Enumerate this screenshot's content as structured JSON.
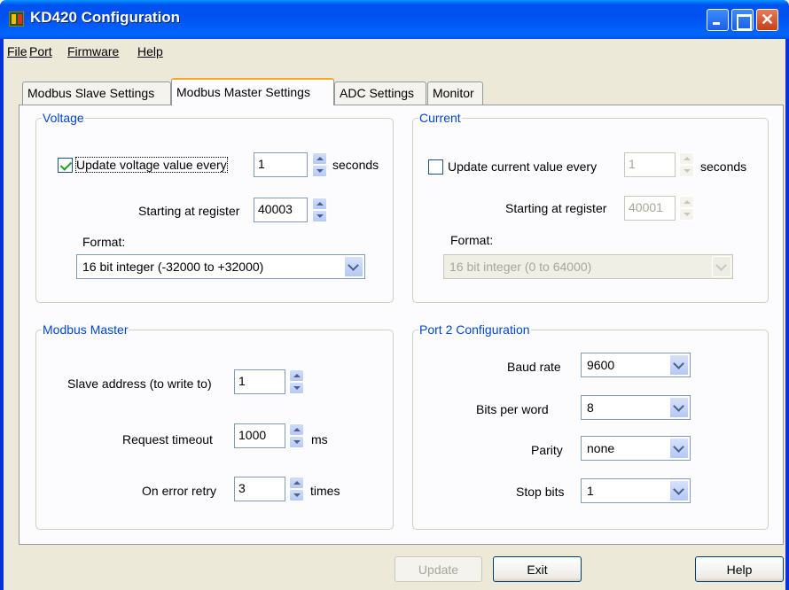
{
  "window": {
    "title": "KD420 Configuration"
  },
  "menubar": [
    "File",
    "Port",
    "Firmware",
    "Help"
  ],
  "tabs": [
    "Modbus Slave Settings",
    "Modbus Master Settings",
    "ADC Settings",
    "Monitor"
  ],
  "active_tab": "Modbus Master Settings",
  "voltage": {
    "legend": "Voltage",
    "update_label": "Update voltage value every",
    "update_checked": true,
    "interval": "1",
    "seconds_label": "seconds",
    "register_label": "Starting at register",
    "register": "40003",
    "format_label": "Format:",
    "format": "16 bit integer (-32000 to +32000)"
  },
  "current": {
    "legend": "Current",
    "update_label": "Update current value every",
    "update_checked": false,
    "interval": "1",
    "seconds_label": "seconds",
    "register_label": "Starting at register",
    "register": "40001",
    "format_label": "Format:",
    "format": "16 bit integer (0 to 64000)"
  },
  "modbus_master": {
    "legend": "Modbus Master",
    "slave_label": "Slave address (to write to)",
    "slave": "1",
    "timeout_label": "Request timeout",
    "timeout": "1000",
    "timeout_unit": "ms",
    "retry_label": "On error retry",
    "retry": "3",
    "retry_unit": "times"
  },
  "port2": {
    "legend": "Port 2 Configuration",
    "baud_label": "Baud rate",
    "baud": "9600",
    "bits_label": "Bits per word",
    "bits": "8",
    "parity_label": "Parity",
    "parity": "none",
    "stop_label": "Stop bits",
    "stop": "1"
  },
  "buttons": {
    "update": "Update",
    "exit": "Exit",
    "help": "Help"
  },
  "colors": {
    "title_bar": "#0054e3",
    "group_legend": "#0046d5",
    "face": "#ece9d8",
    "active_tab_accent": "#f5a623"
  }
}
